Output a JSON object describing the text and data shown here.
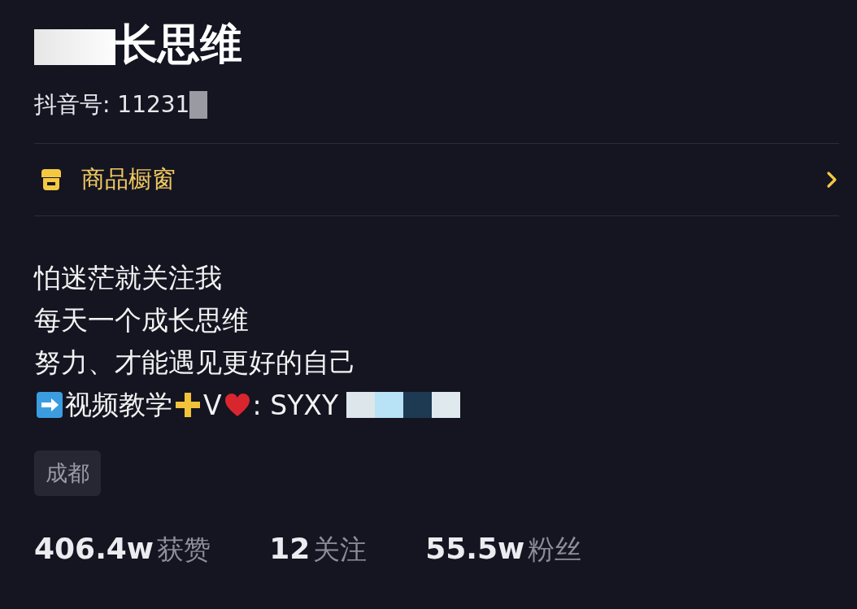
{
  "profile": {
    "name": "长思维",
    "douyin_id": "抖音号: 11231"
  },
  "shop_row": {
    "label": "商品橱窗"
  },
  "bio": {
    "lines": [
      "怕迷茫就关注我",
      "每天一个成长思维",
      "努力、才能遇见更好的自己"
    ],
    "contact": {
      "segments": [
        "视频教学",
        "V",
        ": SYXY"
      ]
    }
  },
  "location_tag": "成都",
  "stats": [
    {
      "value": "406.4w",
      "label": "获赞"
    },
    {
      "value": "12",
      "label": "关注"
    },
    {
      "value": "55.5w",
      "label": "粉丝"
    }
  ]
}
